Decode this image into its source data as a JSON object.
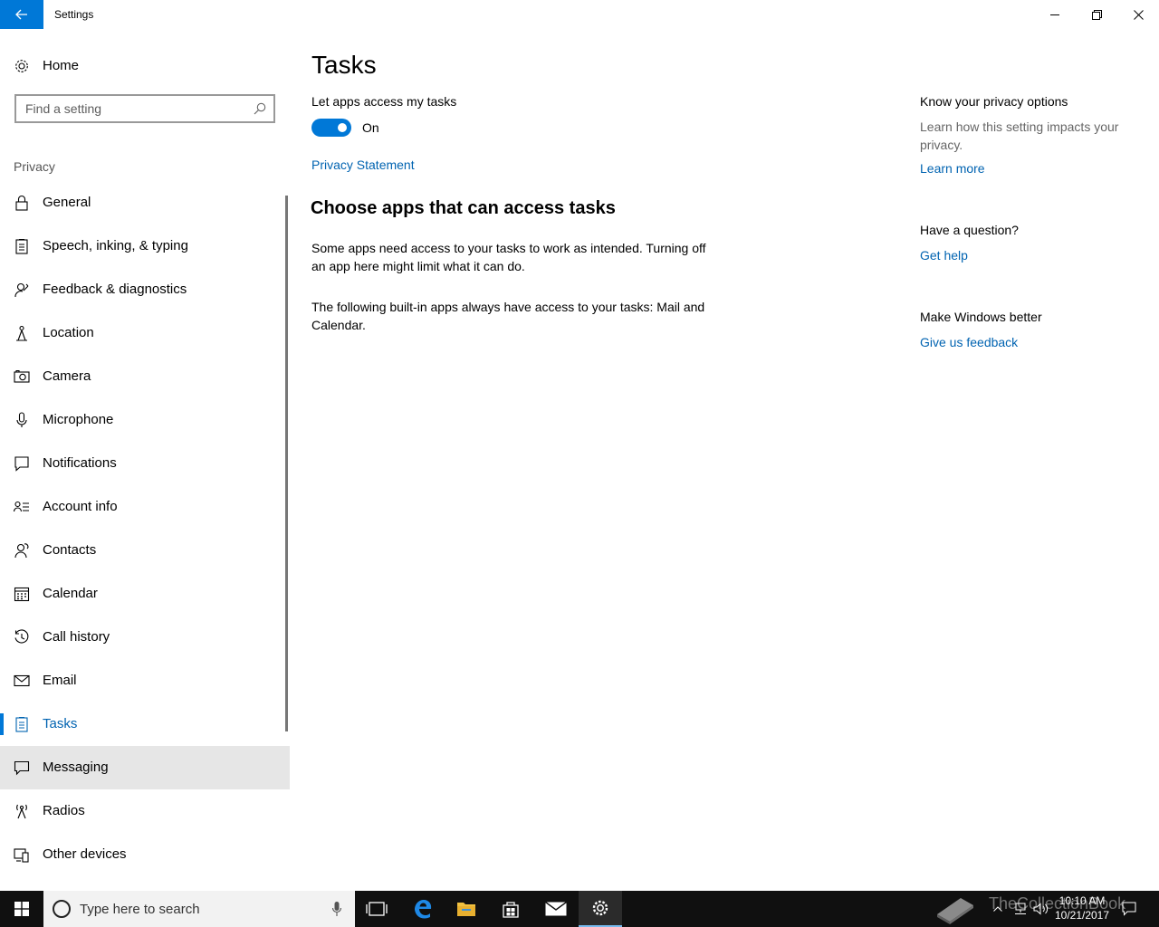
{
  "window": {
    "title": "Settings",
    "minimize_icon": "minimize-icon",
    "maximize_icon": "restore-icon",
    "close_icon": "close-icon"
  },
  "sidebar": {
    "home_label": "Home",
    "search_placeholder": "Find a setting",
    "section": "Privacy",
    "items": [
      {
        "label": "General",
        "icon": "lock-icon"
      },
      {
        "label": "Speech, inking, & typing",
        "icon": "clipboard-icon"
      },
      {
        "label": "Feedback & diagnostics",
        "icon": "person-feedback-icon"
      },
      {
        "label": "Location",
        "icon": "location-person-icon"
      },
      {
        "label": "Camera",
        "icon": "camera-icon"
      },
      {
        "label": "Microphone",
        "icon": "microphone-icon"
      },
      {
        "label": "Notifications",
        "icon": "notification-icon"
      },
      {
        "label": "Account info",
        "icon": "account-info-icon"
      },
      {
        "label": "Contacts",
        "icon": "contacts-icon"
      },
      {
        "label": "Calendar",
        "icon": "calendar-icon"
      },
      {
        "label": "Call history",
        "icon": "history-icon"
      },
      {
        "label": "Email",
        "icon": "email-icon"
      },
      {
        "label": "Tasks",
        "icon": "tasks-icon",
        "selected": true
      },
      {
        "label": "Messaging",
        "icon": "message-icon",
        "hover": true
      },
      {
        "label": "Radios",
        "icon": "radio-tower-icon"
      },
      {
        "label": "Other devices",
        "icon": "devices-icon"
      }
    ]
  },
  "main": {
    "title": "Tasks",
    "toggle_label": "Let apps access my tasks",
    "toggle_state": "On",
    "privacy_link": "Privacy Statement",
    "subheading": "Choose apps that can access tasks",
    "para1": "Some apps need access to your tasks to work as intended. Turning off an app here might limit what it can do.",
    "para2": "The following built-in apps always have access to your tasks: Mail and Calendar."
  },
  "right": {
    "privacy_head": "Know your privacy options",
    "privacy_text": "Learn how this setting impacts your privacy.",
    "learn_more": "Learn more",
    "question_head": "Have a question?",
    "get_help": "Get help",
    "better_head": "Make Windows better",
    "feedback": "Give us feedback"
  },
  "taskbar": {
    "search_placeholder": "Type here to search",
    "time": "10:10 AM",
    "date": "10/21/2017",
    "watermark": "TheCollectionBook"
  },
  "colors": {
    "accent": "#0078d7",
    "link": "#0063b1",
    "taskbar": "#101010"
  }
}
